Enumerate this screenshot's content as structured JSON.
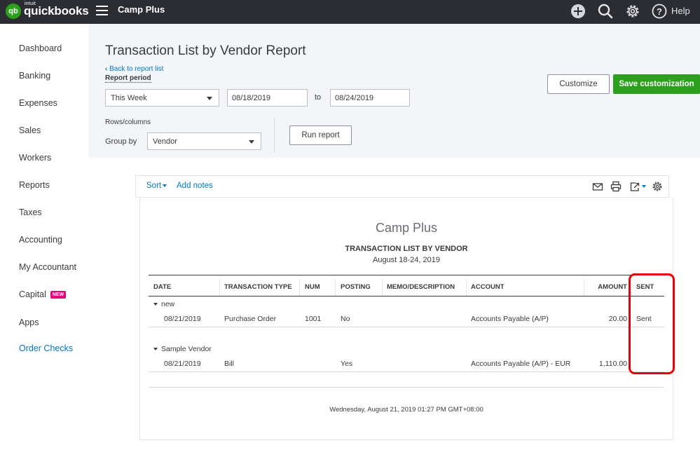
{
  "topbar": {
    "logo_intuit": "intuit",
    "logo_name": "quickbooks",
    "logo_badge": "qb",
    "company": "Camp Plus",
    "icons": [
      "plus-circle-icon",
      "search-icon",
      "gear-icon",
      "help-icon"
    ],
    "help_label": "Help"
  },
  "sidebar": {
    "items": [
      {
        "label": "Dashboard"
      },
      {
        "label": "Banking"
      },
      {
        "label": "Expenses"
      },
      {
        "label": "Sales"
      },
      {
        "label": "Workers"
      },
      {
        "label": "Reports"
      },
      {
        "label": "Taxes"
      },
      {
        "label": "Accounting"
      },
      {
        "label": "My Accountant"
      },
      {
        "label": "Capital",
        "badge": "NEW"
      },
      {
        "label": "Apps"
      },
      {
        "label": "Order Checks"
      }
    ]
  },
  "header": {
    "title": "Transaction List by Vendor Report",
    "back_link": "Back to report list",
    "report_period_label": "Report period",
    "period_select": "This Week",
    "date_from": "08/18/2019",
    "to_label": "to",
    "date_to": "08/24/2019",
    "rows_columns_label": "Rows/columns",
    "group_by_label": "Group by",
    "group_by_value": "Vendor",
    "run_report": "Run report",
    "customize": "Customize",
    "save_customization": "Save customization"
  },
  "toolbar": {
    "sort": "Sort",
    "add_notes": "Add notes",
    "icons": [
      "email-icon",
      "print-icon",
      "export-icon",
      "settings-icon"
    ]
  },
  "report": {
    "company": "Camp Plus",
    "title": "TRANSACTION LIST BY VENDOR",
    "date_range": "August 18-24, 2019",
    "columns": [
      "DATE",
      "TRANSACTION TYPE",
      "NUM",
      "POSTING",
      "MEMO/DESCRIPTION",
      "ACCOUNT",
      "AMOUNT",
      "SENT"
    ],
    "groups": [
      {
        "name": "new",
        "rows": [
          {
            "date": "08/21/2019",
            "type": "Purchase Order",
            "num": "1001",
            "posting": "No",
            "memo": "",
            "account": "Accounts Payable (A/P)",
            "amount": "20.00",
            "sent": "Sent"
          }
        ]
      },
      {
        "name": "Sample Vendor",
        "rows": [
          {
            "date": "08/21/2019",
            "type": "Bill",
            "num": "",
            "posting": "Yes",
            "memo": "",
            "account": "Accounts Payable (A/P) - EUR",
            "amount": "1,110.00",
            "sent": ""
          }
        ]
      }
    ],
    "footer_timestamp": "Wednesday, August 21, 2019  01:27 PM GMT+08:00"
  },
  "colors": {
    "topbar": "#2b2d33",
    "accent_green": "#2ca01c",
    "link_blue": "#0077c5",
    "highlight_red": "#e8000b",
    "badge_pink": "#e6007a"
  }
}
